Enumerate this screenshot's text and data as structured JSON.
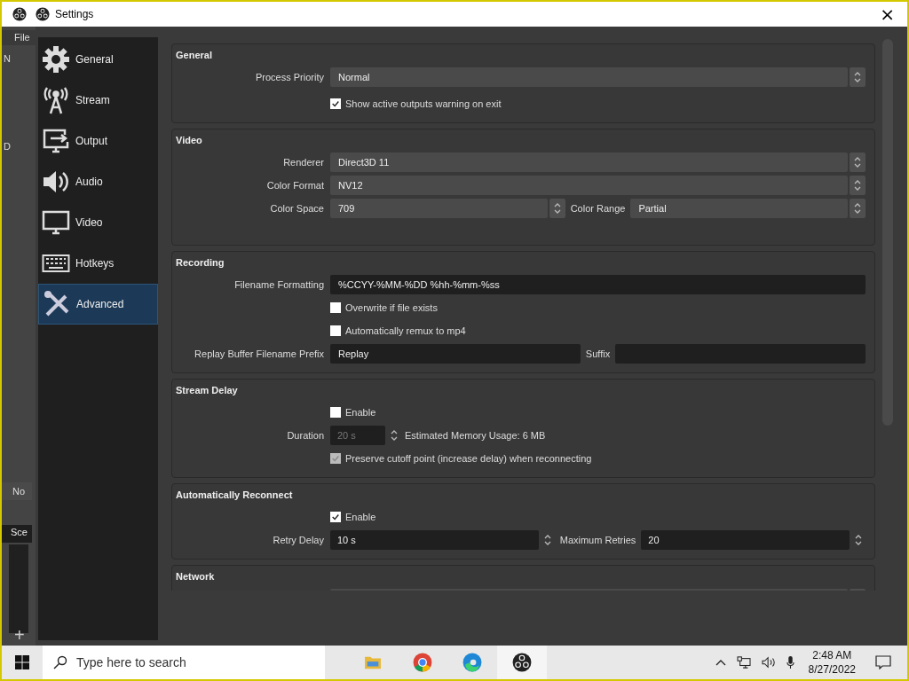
{
  "background_app": {
    "texts": [
      {
        "kind": "menu",
        "text": "File"
      },
      {
        "kind": "frag",
        "text": "N"
      },
      {
        "kind": "frag",
        "text": "D"
      },
      {
        "kind": "frag",
        "text": "No"
      },
      {
        "kind": "dock",
        "text": "Sce"
      }
    ],
    "add_label": "+"
  },
  "window": {
    "title": "Settings",
    "close": "×"
  },
  "sidebar": {
    "items": [
      {
        "label": "General",
        "selected": false
      },
      {
        "label": "Stream",
        "selected": false
      },
      {
        "label": "Output",
        "selected": false
      },
      {
        "label": "Audio",
        "selected": false
      },
      {
        "label": "Video",
        "selected": false
      },
      {
        "label": "Hotkeys",
        "selected": false
      },
      {
        "label": "Advanced",
        "selected": true
      }
    ]
  },
  "groups": [
    {
      "title": "General",
      "rows": [
        {
          "kind": "combo",
          "label": "Process Priority",
          "value": "Normal"
        },
        {
          "kind": "check",
          "text": "Show active outputs warning on exit",
          "checked": true,
          "disabled": false
        }
      ]
    },
    {
      "title": "Video",
      "rows": [
        {
          "kind": "combo",
          "label": "Renderer",
          "value": "Direct3D 11"
        },
        {
          "kind": "combo",
          "label": "Color Format",
          "value": "NV12"
        },
        {
          "kind": "combo_pair",
          "label": "Color Space",
          "value": "709",
          "label2": "Color Range",
          "value2": "Partial"
        }
      ]
    },
    {
      "title": "Recording",
      "rows": [
        {
          "kind": "text",
          "label": "Filename Formatting",
          "value": "%CCYY-%MM-%DD %hh-%mm-%ss"
        },
        {
          "kind": "check",
          "text": "Overwrite if file exists",
          "checked": false,
          "disabled": false
        },
        {
          "kind": "check",
          "text": "Automatically remux to mp4",
          "checked": false,
          "disabled": false
        },
        {
          "kind": "text_pair",
          "label": "Replay Buffer Filename Prefix",
          "value": "Replay",
          "label2": "Suffix"
        }
      ]
    },
    {
      "title": "Stream Delay",
      "rows": [
        {
          "kind": "check",
          "text": "Enable",
          "checked": false,
          "disabled": false
        },
        {
          "kind": "spin",
          "label": "Duration",
          "value": "20 s",
          "note": "Estimated Memory Usage: 6 MB",
          "disabled": true
        },
        {
          "kind": "check",
          "text": "Preserve cutoff point (increase delay) when reconnecting",
          "checked": true,
          "disabled": true
        }
      ]
    },
    {
      "title": "Automatically Reconnect",
      "rows": [
        {
          "kind": "check",
          "text": "Enable",
          "checked": true,
          "disabled": false
        },
        {
          "kind": "spin_pair",
          "label": "Retry Delay",
          "value": "10 s",
          "label2": "Maximum Retries",
          "value2": "20"
        }
      ]
    },
    {
      "title": "Network",
      "rows": [
        {
          "kind": "combo_cut"
        }
      ]
    }
  ],
  "taskbar": {
    "search_placeholder": "Type here to search",
    "time": "2:48 AM",
    "date": "8/27/2022"
  }
}
